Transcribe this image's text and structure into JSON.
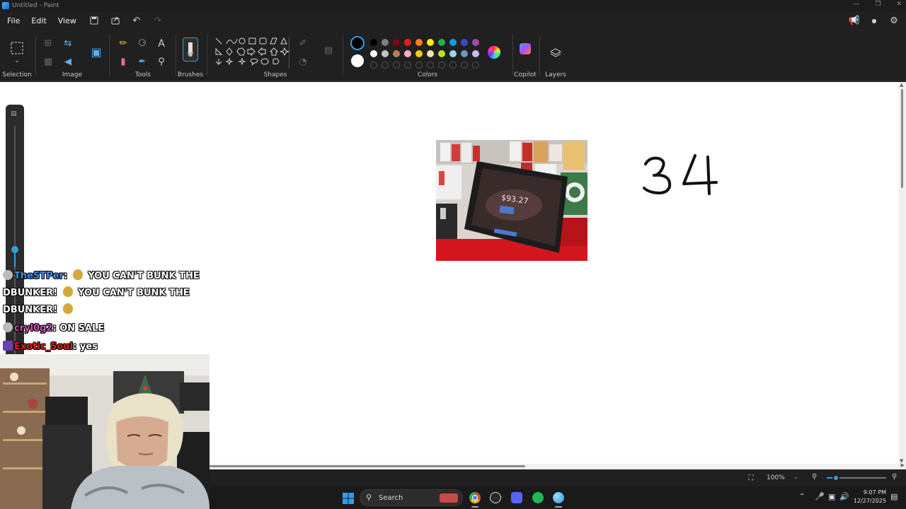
{
  "window": {
    "title": "Untitled - Paint"
  },
  "menu": {
    "file": "File",
    "edit": "Edit",
    "view": "View"
  },
  "ribbon": {
    "groups": {
      "selection": "Selection",
      "image": "Image",
      "tools": "Tools",
      "brushes": "Brushes",
      "shapes": "Shapes",
      "colors": "Colors",
      "copilot": "Copilot",
      "layers": "Layers"
    },
    "palette_row1": [
      "#000000",
      "#7f7f7f",
      "#880015",
      "#ed1c24",
      "#ff7f27",
      "#fff200",
      "#22b14c",
      "#00a2e8",
      "#3f48cc",
      "#a349a4"
    ],
    "palette_row2": [
      "#ffffff",
      "#c3c3c3",
      "#b97a57",
      "#ffaec9",
      "#ffc90e",
      "#efe4b0",
      "#b5e61d",
      "#99d9ea",
      "#7092be",
      "#c8bfe7"
    ],
    "primary_color": "#000000",
    "secondary_color": "#ffffff"
  },
  "canvas": {
    "handwriting": "34",
    "photo_price": "$93.27"
  },
  "chat": [
    {
      "user": "TheSTPer",
      "message": "YOU CAN'T BUNK THE DBUNKER!",
      "message2": "YOU CAN'T BUNK THE DBUNKER!"
    },
    {
      "user": "cryl0g2",
      "message": "ON SALE"
    },
    {
      "user": "Exotic_Soul",
      "message": "yes"
    }
  ],
  "status": {
    "zoom": "100%"
  },
  "taskbar": {
    "search_placeholder": "Search",
    "time": "9:07 PM",
    "date": "12/27/2025"
  }
}
